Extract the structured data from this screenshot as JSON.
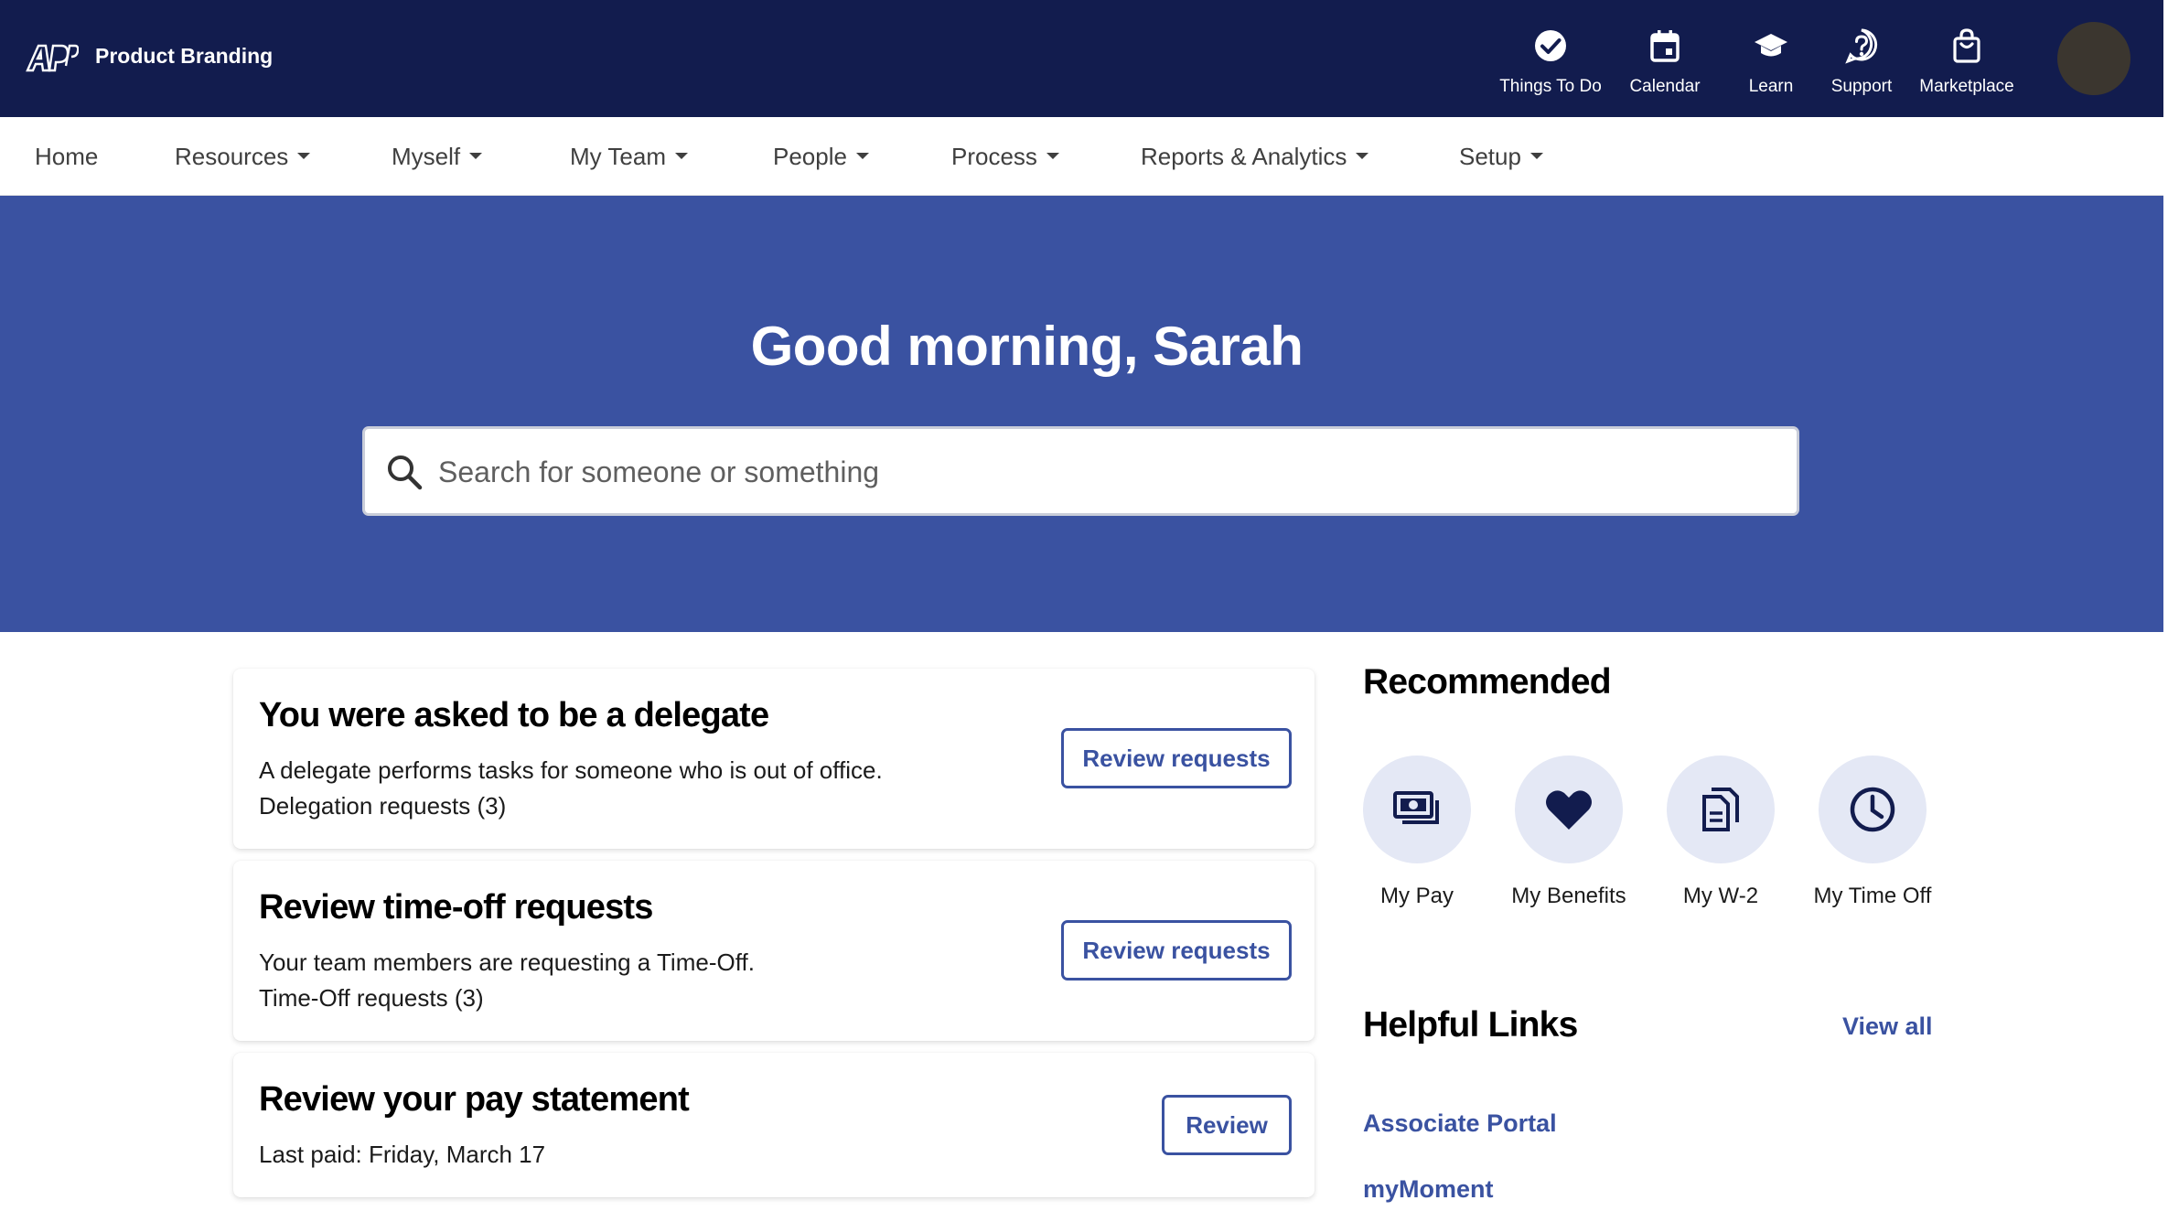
{
  "header": {
    "brand": "Product Branding",
    "logo_text": "ADP",
    "background": "#121c4e",
    "nav": [
      {
        "label": "Things To Do",
        "icon": "check-circle-icon"
      },
      {
        "label": "Calendar",
        "icon": "calendar-icon"
      },
      {
        "label": "Learn",
        "icon": "graduation-cap-icon"
      },
      {
        "label": "Support",
        "icon": "question-circle-icon"
      },
      {
        "label": "Marketplace",
        "icon": "shopping-bag-icon"
      }
    ]
  },
  "main_nav": {
    "items": [
      {
        "label": "Home",
        "has_menu": false
      },
      {
        "label": "Resources",
        "has_menu": true
      },
      {
        "label": "Myself",
        "has_menu": true
      },
      {
        "label": "My Team",
        "has_menu": true
      },
      {
        "label": "People",
        "has_menu": true
      },
      {
        "label": "Process",
        "has_menu": true
      },
      {
        "label": "Reports & Analytics",
        "has_menu": true
      },
      {
        "label": "Setup",
        "has_menu": true
      }
    ]
  },
  "hero": {
    "greeting": "Good morning, Sarah",
    "search_placeholder": "Search for someone or something",
    "background": "#3a52a1"
  },
  "cards": [
    {
      "title": "You were asked to be a delegate",
      "lines": [
        "A delegate performs tasks for someone who is out of office.",
        "Delegation requests (3)"
      ],
      "button": "Review requests"
    },
    {
      "title": "Review time-off requests",
      "lines": [
        "Your team members are requesting a Time-Off.",
        "Time-Off requests (3)"
      ],
      "button": "Review requests"
    },
    {
      "title": "Review your pay statement",
      "lines": [
        "Last paid: Friday, March 17"
      ],
      "button": "Review"
    }
  ],
  "recommended": {
    "title": "Recommended",
    "items": [
      {
        "label": "My Pay",
        "icon": "money-icon"
      },
      {
        "label": "My Benefits",
        "icon": "heart-icon"
      },
      {
        "label": "My W-2",
        "icon": "document-icon"
      },
      {
        "label": "My Time Off",
        "icon": "clock-icon"
      }
    ]
  },
  "helpful_links": {
    "title": "Helpful Links",
    "view_all": "View all",
    "links": [
      "Associate Portal",
      "myMoment"
    ]
  },
  "colors": {
    "accent": "#3a52a1",
    "icon_circle": "#e4e8f5",
    "avatar": "#3b362f"
  }
}
